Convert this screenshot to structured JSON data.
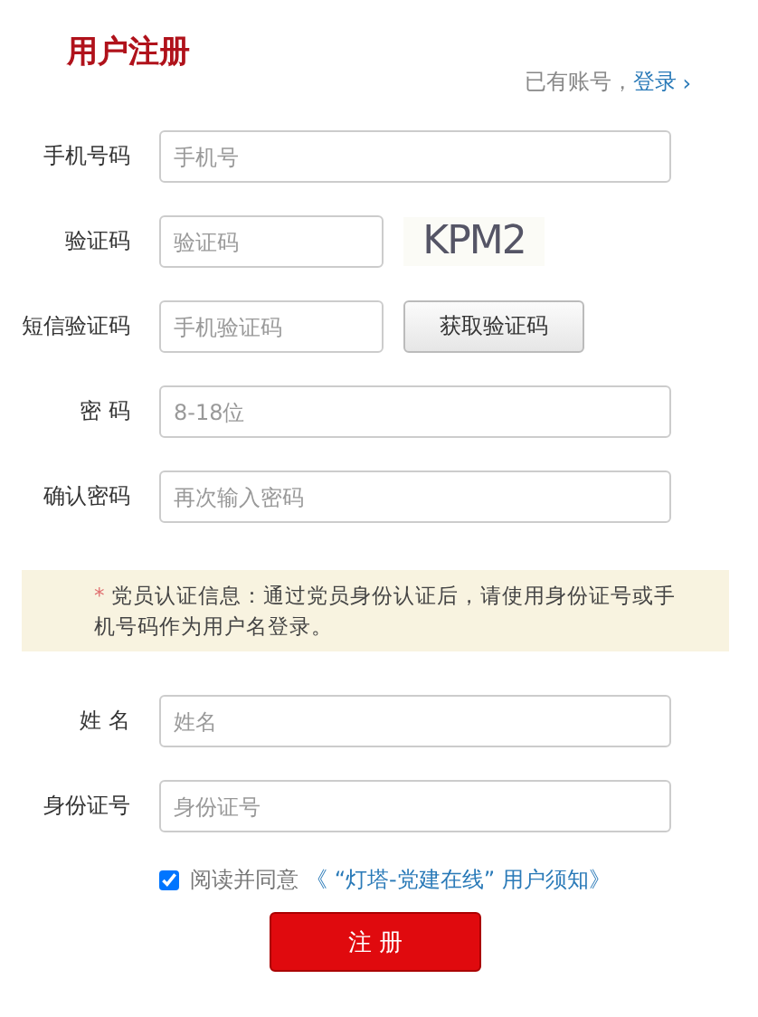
{
  "title": "用户注册",
  "login_prompt": {
    "text": "已有账号，",
    "link": "登录",
    "arrow": "›"
  },
  "fields": [
    {
      "kind": "input",
      "label": "手机号码",
      "placeholder": "手机号"
    },
    {
      "kind": "captcha",
      "label": "验证码",
      "placeholder": "验证码",
      "captcha": "KPM2"
    },
    {
      "kind": "sms",
      "label": "短信验证码",
      "placeholder": "手机验证码",
      "button": "获取验证码"
    },
    {
      "kind": "input",
      "label": "密 码",
      "placeholder": "8-18位"
    },
    {
      "kind": "input",
      "label": "确认密码",
      "placeholder": "再次输入密码"
    }
  ],
  "notice": {
    "mark": "*",
    "text": "党员认证信息：通过党员身份认证后，请使用身份证号或手机号码作为用户名登录。"
  },
  "member_fields": [
    {
      "kind": "input",
      "label": "姓 名",
      "placeholder": "姓名"
    },
    {
      "kind": "input",
      "label": "身份证号",
      "placeholder": "身份证号"
    }
  ],
  "agreement": {
    "checked": true,
    "text": "阅读并同意",
    "link": "《 “灯塔-党建在线” 用户须知》"
  },
  "submit": "注 册"
}
